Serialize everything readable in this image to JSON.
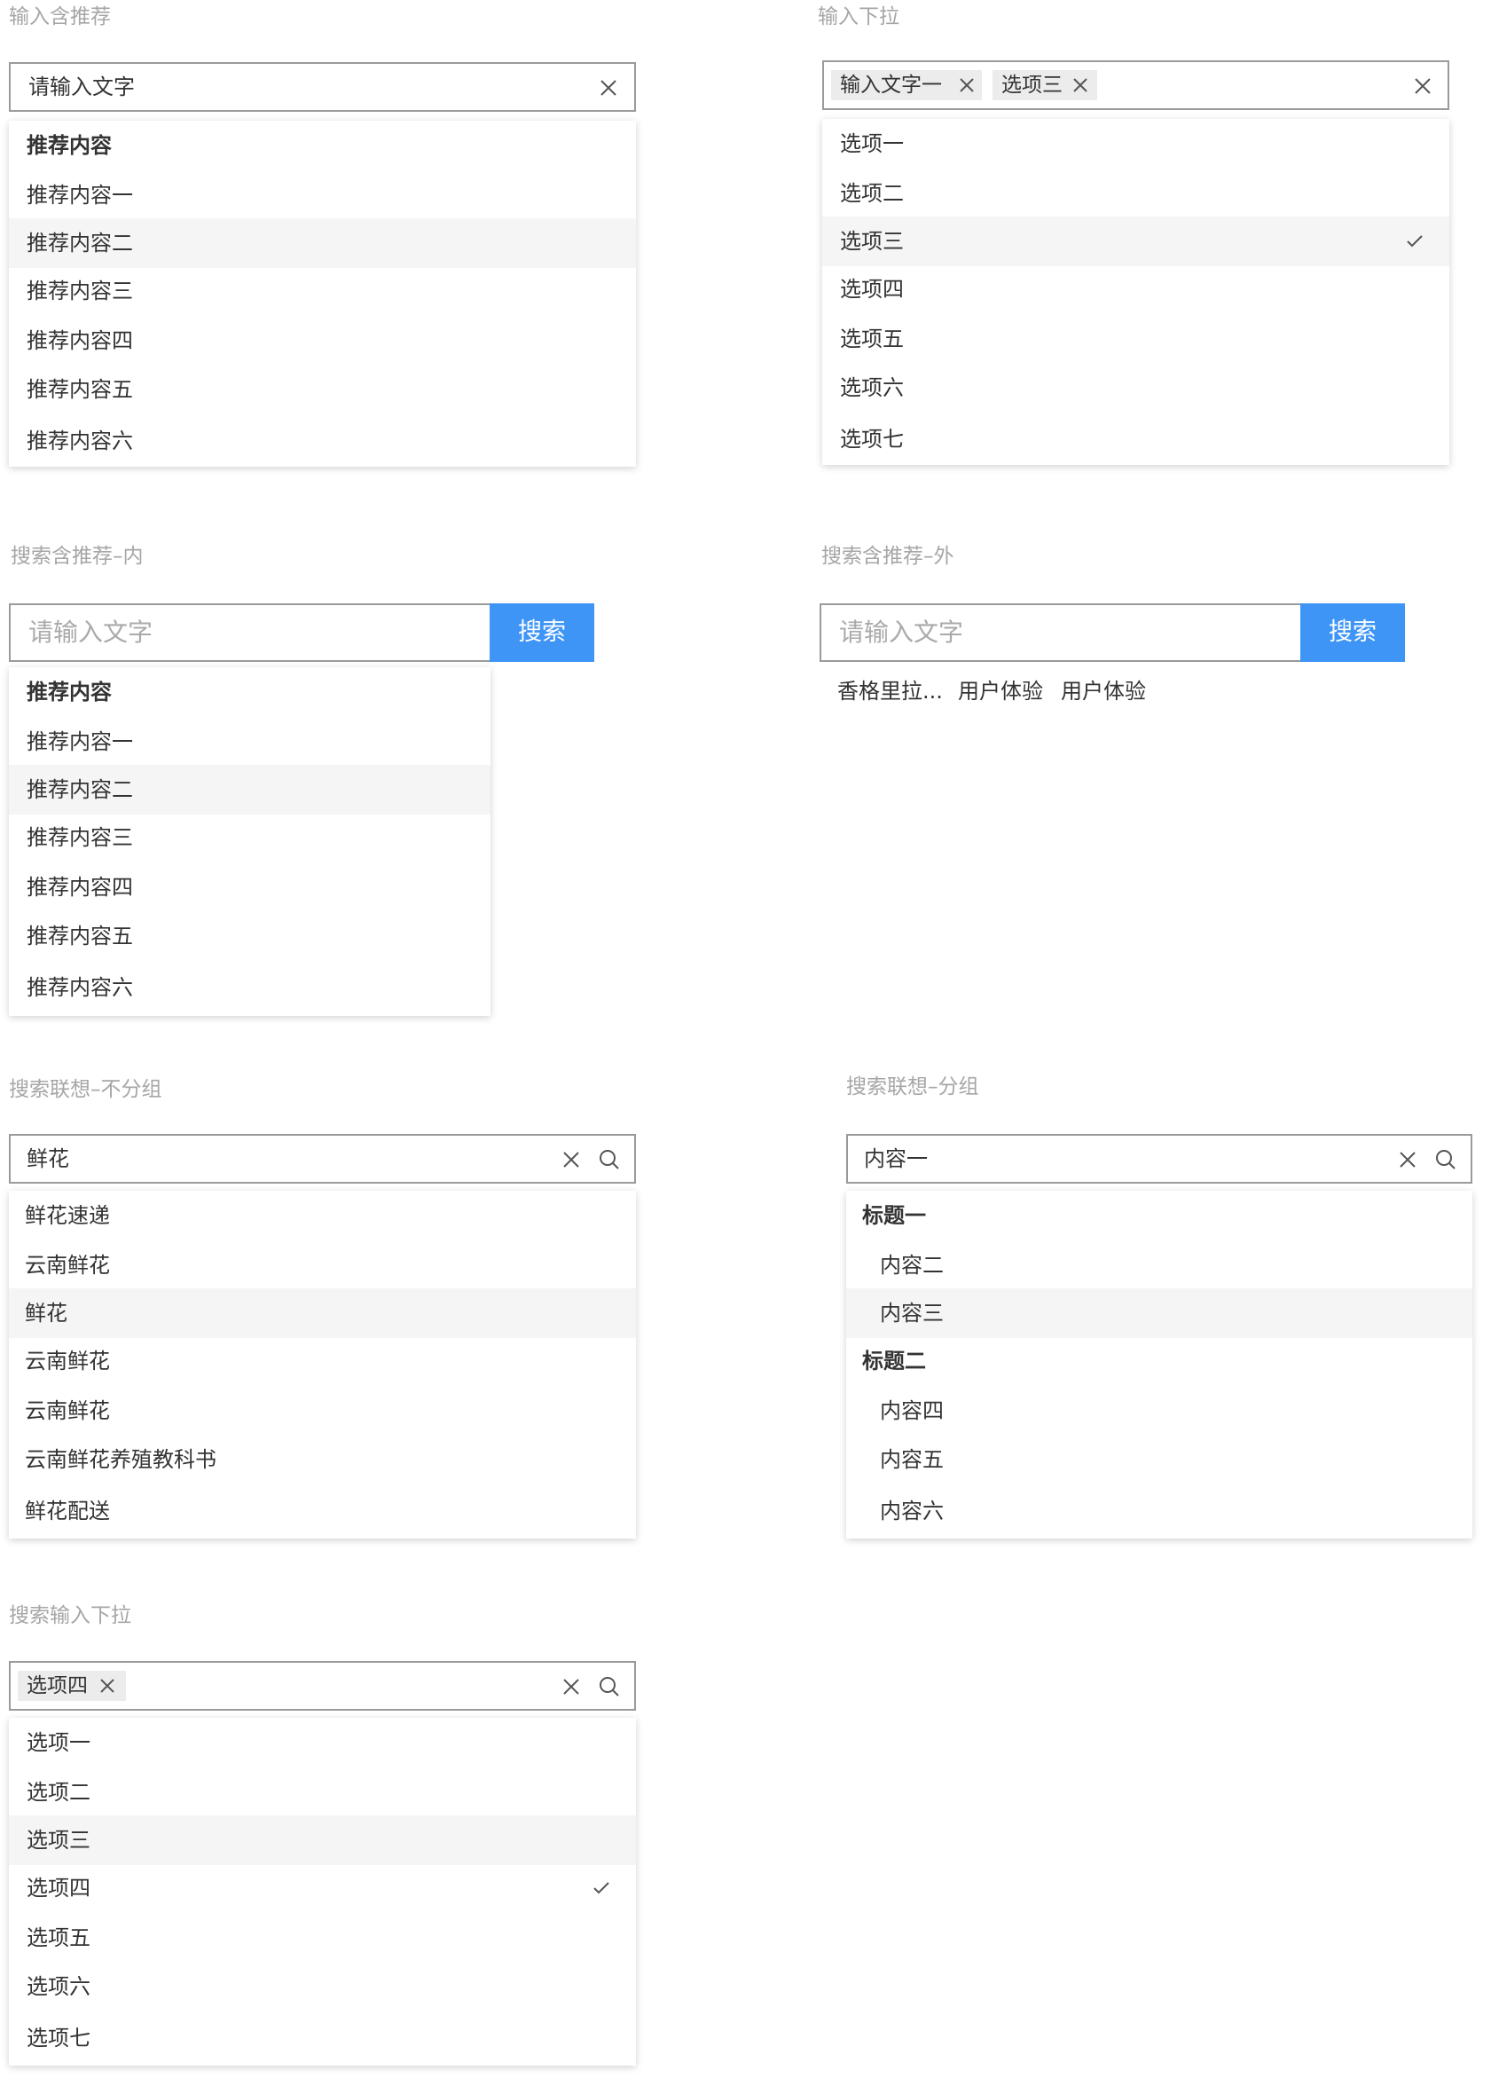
{
  "colors": {
    "accent": "#3e95f6",
    "highlight_row": "#f5f5f5",
    "tag_bg": "#ececec",
    "section_title": "#a6a6a6"
  },
  "icons": {
    "clear": "close-icon",
    "search": "search-icon",
    "selected": "check-icon",
    "tag_remove": "close-icon"
  },
  "section1": {
    "title": "输入含推荐",
    "input_value": "请输入文字",
    "items": [
      {
        "label": "推荐内容",
        "type": "header"
      },
      {
        "label": "推荐内容一"
      },
      {
        "label": "推荐内容二",
        "highlighted": true
      },
      {
        "label": "推荐内容三"
      },
      {
        "label": "推荐内容四"
      },
      {
        "label": "推荐内容五"
      },
      {
        "label": "推荐内容六"
      }
    ]
  },
  "section2": {
    "title": "输入下拉",
    "tags": [
      "输入文字一",
      "选项三"
    ],
    "items": [
      {
        "label": "选项一"
      },
      {
        "label": "选项二"
      },
      {
        "label": "选项三",
        "highlighted": true,
        "selected": true
      },
      {
        "label": "选项四"
      },
      {
        "label": "选项五"
      },
      {
        "label": "选项六"
      },
      {
        "label": "选项七"
      }
    ]
  },
  "section3": {
    "title": "搜索含推荐–内",
    "placeholder": "请输入文字",
    "button_label": "搜索",
    "items": [
      {
        "label": "推荐内容",
        "type": "header"
      },
      {
        "label": "推荐内容一"
      },
      {
        "label": "推荐内容二",
        "highlighted": true
      },
      {
        "label": "推荐内容三"
      },
      {
        "label": "推荐内容四"
      },
      {
        "label": "推荐内容五"
      },
      {
        "label": "推荐内容六"
      }
    ]
  },
  "section4": {
    "title": "搜索含推荐–外",
    "placeholder": "请输入文字",
    "button_label": "搜索",
    "suggestions": [
      "香格里拉...",
      "用户体验",
      "用户体验"
    ]
  },
  "section5": {
    "title": "搜索联想–不分组",
    "input_value": "鲜花",
    "items": [
      {
        "label": "鲜花速递"
      },
      {
        "label": "云南鲜花"
      },
      {
        "label": "鲜花",
        "highlighted": true
      },
      {
        "label": "云南鲜花"
      },
      {
        "label": "云南鲜花"
      },
      {
        "label": "云南鲜花养殖教科书"
      },
      {
        "label": "鲜花配送"
      }
    ]
  },
  "section6": {
    "title": "搜索联想–分组",
    "input_value": "内容一",
    "items": [
      {
        "label": "标题一",
        "type": "header"
      },
      {
        "label": "内容二",
        "indent": true
      },
      {
        "label": "内容三",
        "indent": true,
        "highlighted": true
      },
      {
        "label": "标题二",
        "type": "header"
      },
      {
        "label": "内容四",
        "indent": true
      },
      {
        "label": "内容五",
        "indent": true
      },
      {
        "label": "内容六",
        "indent": true
      }
    ]
  },
  "section7": {
    "title": "搜索输入下拉",
    "tags": [
      "选项四"
    ],
    "items": [
      {
        "label": "选项一"
      },
      {
        "label": "选项二"
      },
      {
        "label": "选项三",
        "highlighted": true
      },
      {
        "label": "选项四",
        "selected": true
      },
      {
        "label": "选项五"
      },
      {
        "label": "选项六"
      },
      {
        "label": "选项七"
      }
    ]
  }
}
